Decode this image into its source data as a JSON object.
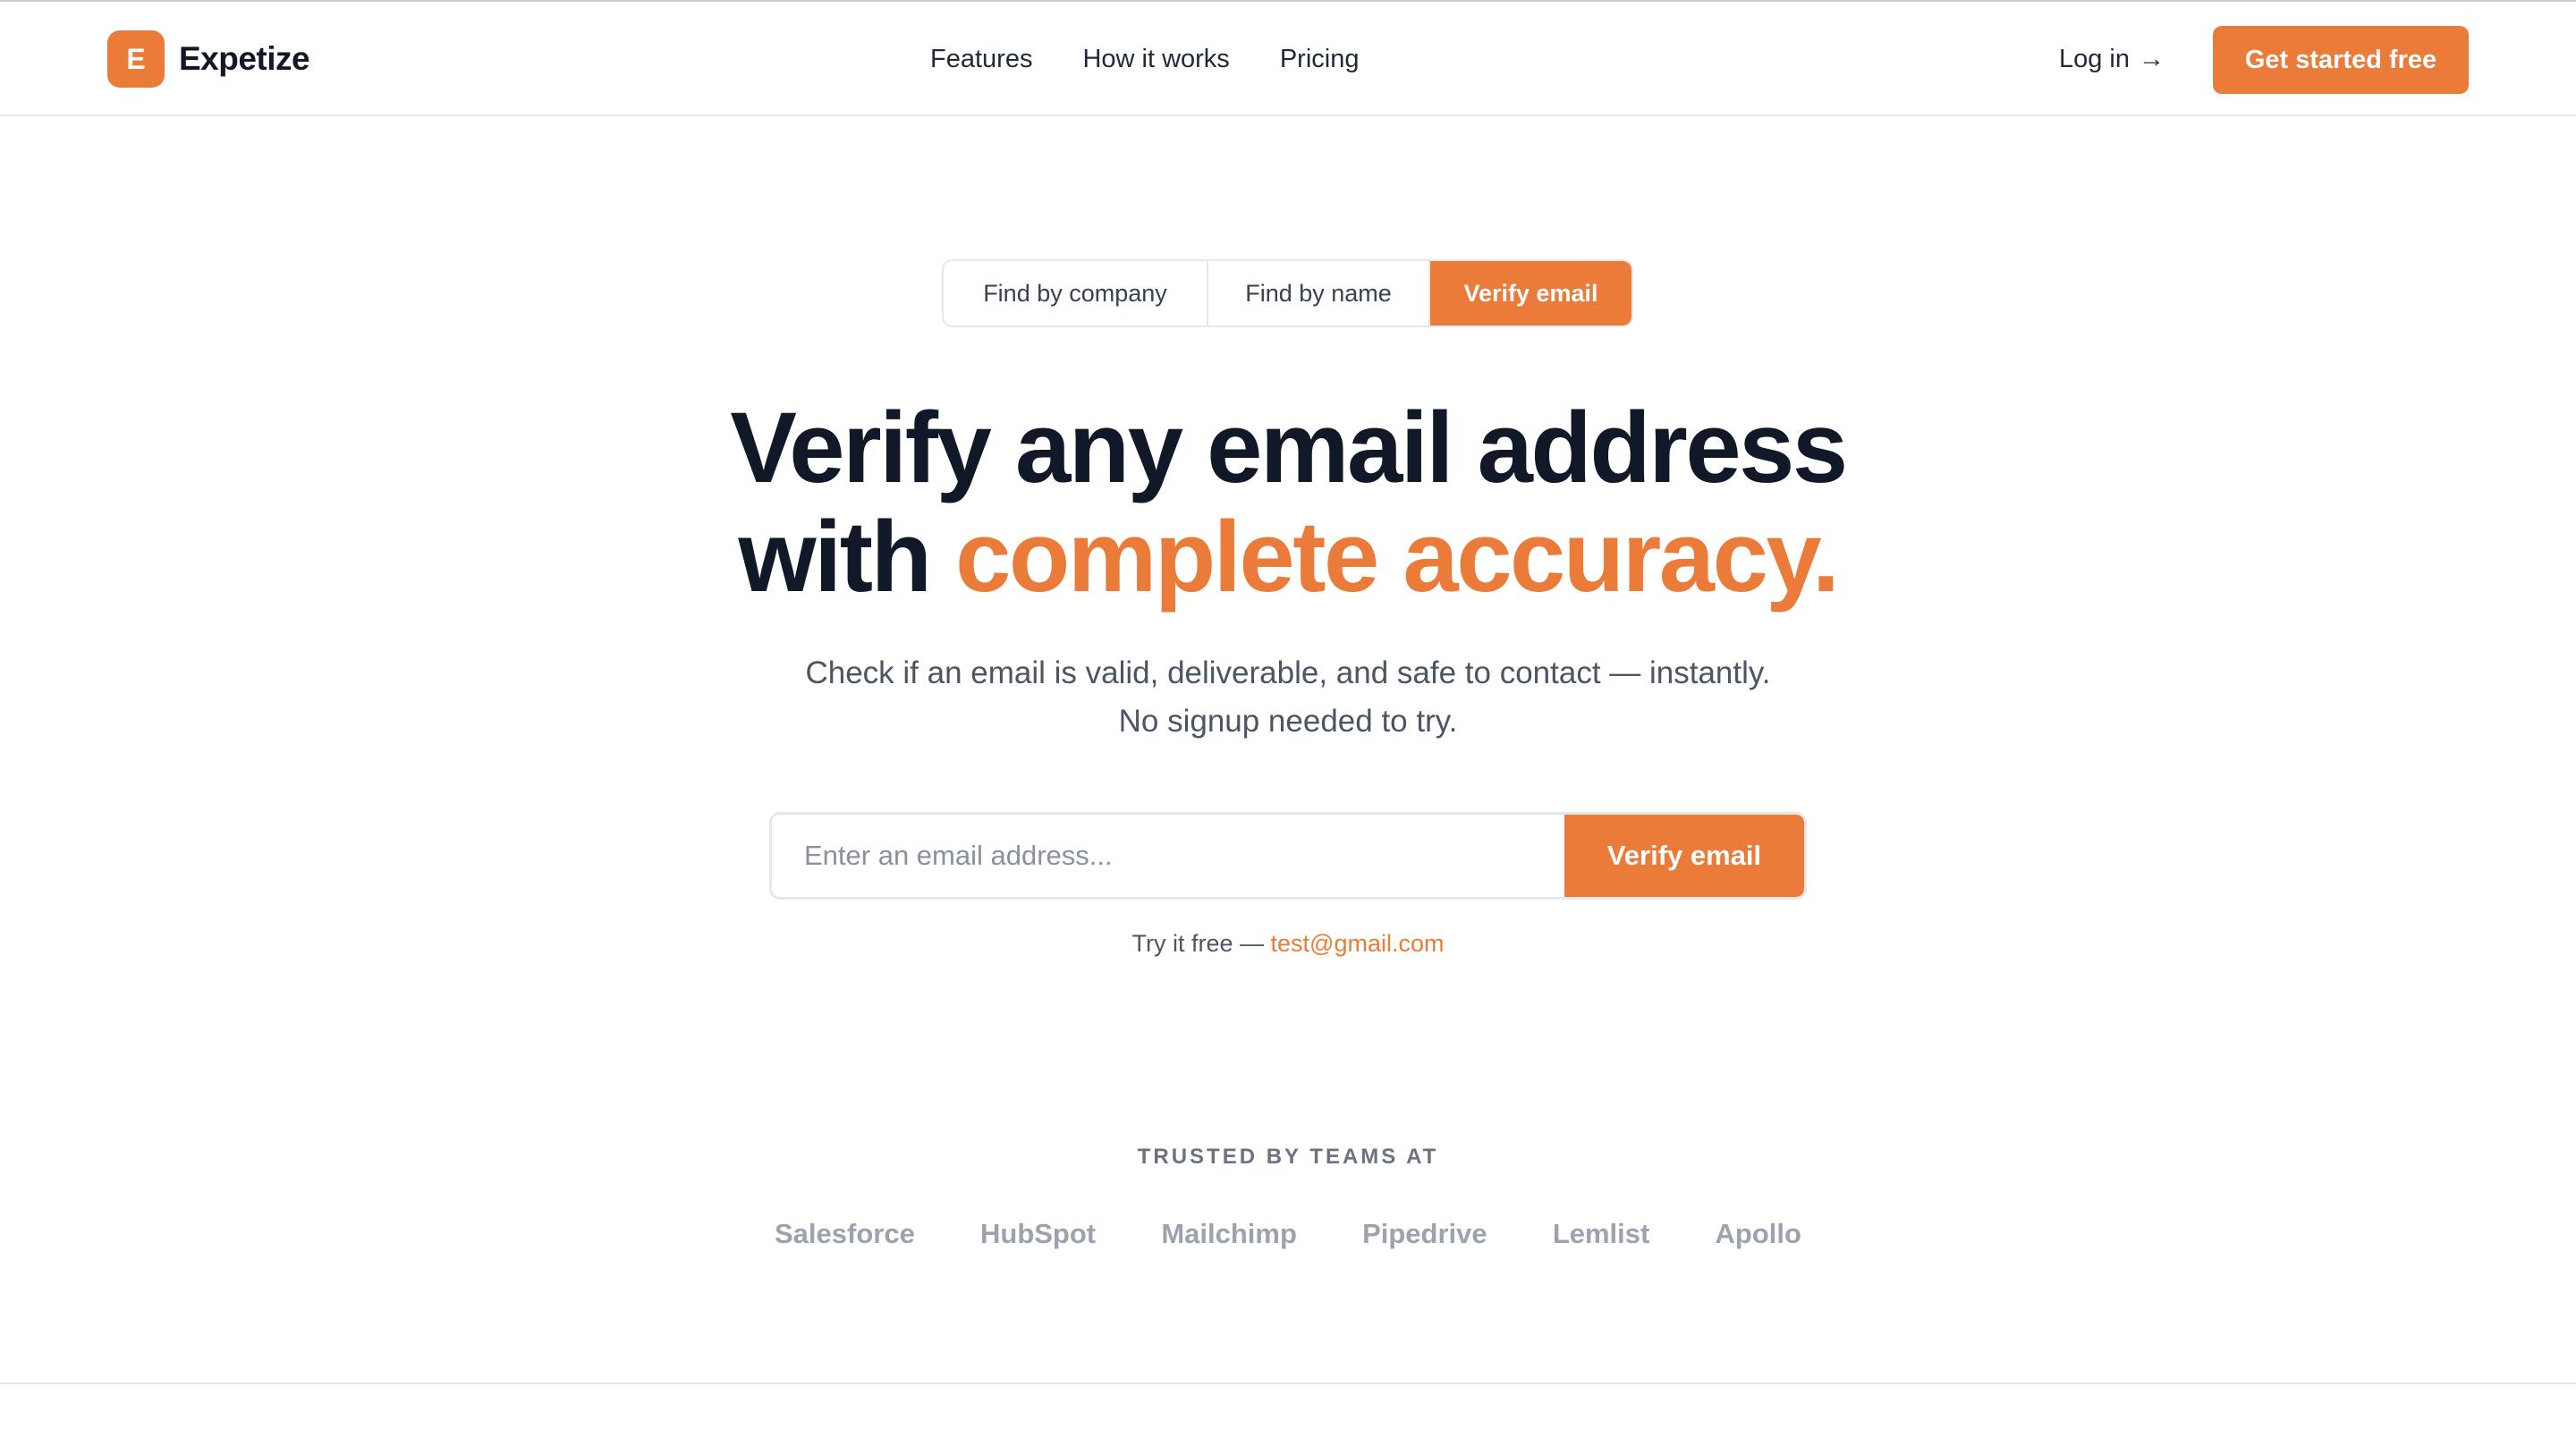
{
  "brand": {
    "mark": "E",
    "name": "Expetize"
  },
  "nav": {
    "items": [
      {
        "label": "Features"
      },
      {
        "label": "How it works"
      },
      {
        "label": "Pricing"
      }
    ],
    "login_label": "Log in",
    "login_arrow": "→",
    "cta_label": "Get started free"
  },
  "tabs": [
    {
      "label": "Find by company",
      "active": false
    },
    {
      "label": "Find by name",
      "active": false
    },
    {
      "label": "Verify email",
      "active": true
    }
  ],
  "hero": {
    "title_line1": "Verify any email address",
    "title_line2_prefix": "with ",
    "title_line2_accent": "complete accuracy.",
    "subtitle_line1": "Check if an email is valid, deliverable, and safe to contact — instantly.",
    "subtitle_line2": "No signup needed to try."
  },
  "verify_form": {
    "placeholder": "Enter an email address...",
    "value": "",
    "button_label": "Verify email",
    "try_prefix": "Try it free — ",
    "try_example": "test@gmail.com"
  },
  "trusted": {
    "label": "TRUSTED BY TEAMS AT",
    "logos": [
      "Salesforce",
      "HubSpot",
      "Mailchimp",
      "Pipedrive",
      "Lemlist",
      "Apollo"
    ]
  },
  "colors": {
    "accent": "#ea7b39",
    "text_dark": "#111827",
    "text_muted": "#4b5563",
    "logo_gray": "#9ca3af"
  }
}
